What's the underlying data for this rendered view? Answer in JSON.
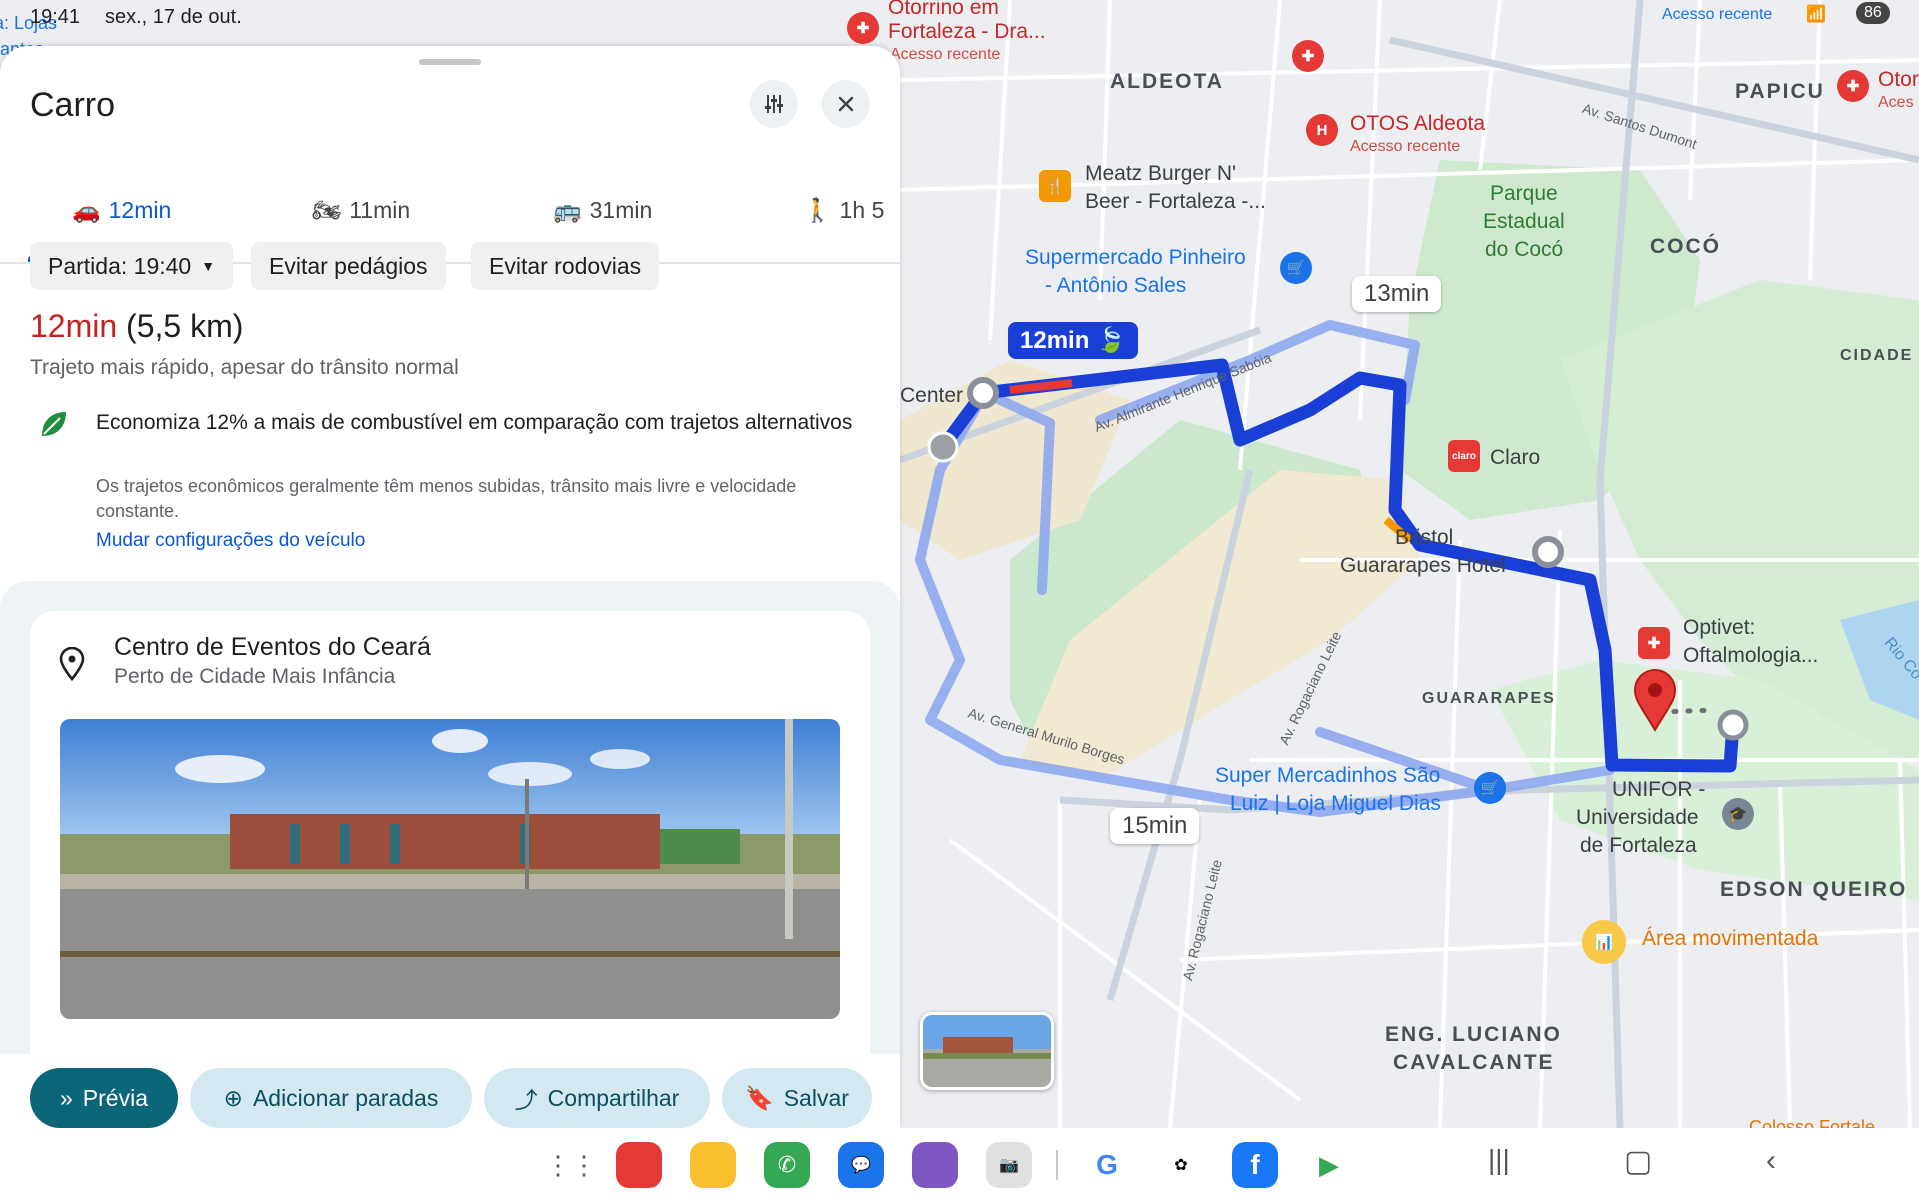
{
  "status_bar": {
    "time": "19:41",
    "date": "sex., 17 de out.",
    "battery": "86",
    "notification_label": "Acesso recente"
  },
  "panel": {
    "title": "Carro",
    "tabs": [
      {
        "mode": "car",
        "label": "12min",
        "icon": "car-icon"
      },
      {
        "mode": "motorcycle",
        "label": "11min",
        "icon": "motorcycle-icon"
      },
      {
        "mode": "transit",
        "label": "31min",
        "icon": "bus-icon"
      },
      {
        "mode": "walking",
        "label": "1h 5",
        "icon": "walk-icon"
      }
    ],
    "options": {
      "departure": "Partida: 19:40",
      "avoid_tolls": "Evitar pedágios",
      "avoid_highways": "Evitar rodovias"
    },
    "summary": {
      "duration": "12min",
      "distance": "(5,5 km)",
      "description": "Trajeto mais rápido, apesar do trânsito normal"
    },
    "eco": {
      "title": "Economiza 12% a mais de combustível em comparação com trajetos alternativos",
      "description": "Os trajetos econômicos geralmente têm menos subidas, trânsito mais livre e velocidade constante.",
      "link": "Mudar configurações do veículo"
    },
    "destination": {
      "name": "Centro de Eventos do Ceará",
      "nearby": "Perto de Cidade Mais Infância"
    },
    "actions": {
      "preview": "Prévia",
      "add_stops": "Adicionar paradas",
      "share": "Compartilhar",
      "save": "Salvar"
    }
  },
  "map": {
    "neighborhoods": {
      "aldeota": "ALDEOTA",
      "papicu": "PAPICU",
      "coco": "COCÓ",
      "cidade": "CIDADE",
      "guararapes": "GUARARAPES",
      "edson": "EDSON QUEIRO",
      "eng1": "ENG. LUCIANO",
      "eng2": "CAVALCANTE"
    },
    "pois": {
      "otorrino1": "Otorrino em",
      "otorrino2": "Fortaleza - Dra...",
      "otorrino_sub": "Acesso recente",
      "otos1": "OTOS Aldeota",
      "otos_sub": "Acesso recente",
      "oto_right": "Otor",
      "oto_right_sub": "Aces",
      "meatz1": "Meatz Burger N'",
      "meatz2": "Beer - Fortaleza -...",
      "pinheiro1": "Supermercado Pinheiro",
      "pinheiro2": "- Antônio Sales",
      "parque1": "Parque",
      "parque2": "Estadual",
      "parque3": "do Cocó",
      "claro": "Claro",
      "bristol1": "Bristol",
      "bristol2": "Guararapes Hotel",
      "optivet1": "Optivet:",
      "optivet2": "Oftalmologia...",
      "super1": "Super Mercadinhos São",
      "super2": "Luiz | Loja Miguel Dias",
      "unifor1": "UNIFOR -",
      "unifor2": "Universidade",
      "unifor3": "de Fortaleza",
      "area": "Área movimentada",
      "center": "Center",
      "left_top1": "a: Lojas",
      "left_top2": "rantes",
      "colosso": "Colosso Fortale",
      "rio": "Rio Co"
    },
    "streets": {
      "santos": "Av. Santos Dumont",
      "almirante": "Av. Almirante Henrique Sabóia",
      "murilo": "Av. General Murilo Borges",
      "rogaciano1": "Av. Rogaciano Leite",
      "rogaciano2": "Av. Rogaciano Leite"
    },
    "route_times": {
      "main": "12min",
      "alt1": "13min",
      "alt2": "15min"
    }
  },
  "colors": {
    "accent": "#0b57d0",
    "route": "#1a3fd6",
    "traffic_red": "#e53935",
    "primary_button": "#0b6679"
  }
}
